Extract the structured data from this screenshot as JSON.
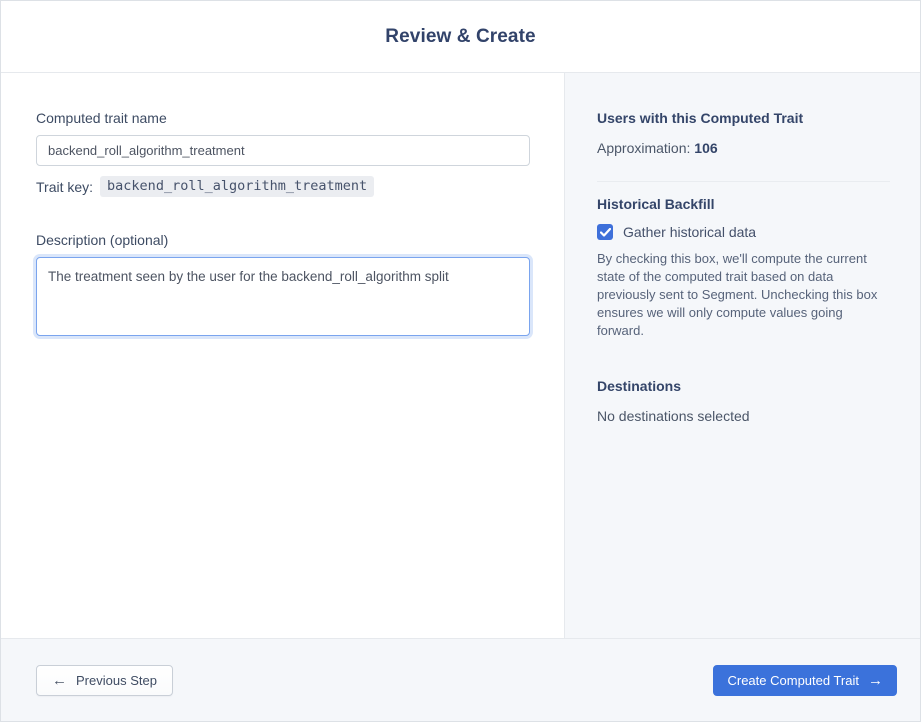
{
  "header": {
    "title": "Review & Create"
  },
  "form": {
    "name_label": "Computed trait name",
    "name_value": "backend_roll_algorithm_treatment",
    "trait_key_label": "Trait key:",
    "trait_key_value": "backend_roll_algorithm_treatment",
    "description_label": "Description (optional)",
    "description_value": "The treatment seen by the user for the backend_roll_algorithm split"
  },
  "summary": {
    "users_heading": "Users with this Computed Trait",
    "approximation_label": "Approximation:",
    "approximation_value": "106",
    "backfill_heading": "Historical Backfill",
    "backfill_checkbox_label": "Gather historical data",
    "backfill_checkbox_checked": true,
    "backfill_description": "By checking this box, we'll compute the current state of the computed trait based on data previously sent to Segment. Unchecking this box ensures we will only compute values going forward.",
    "destinations_heading": "Destinations",
    "destinations_value": "No destinations selected"
  },
  "footer": {
    "previous_label": "Previous Step",
    "create_label": "Create Computed Trait"
  },
  "icons": {
    "arrow_left": "←",
    "arrow_right": "→"
  },
  "colors": {
    "accent_blue": "#3b72db",
    "checkbox_blue": "#3e70da",
    "heading_text": "#344569",
    "body_text": "#4b5668",
    "panel_bg": "#f5f7fa",
    "border": "#e6e9ed"
  }
}
